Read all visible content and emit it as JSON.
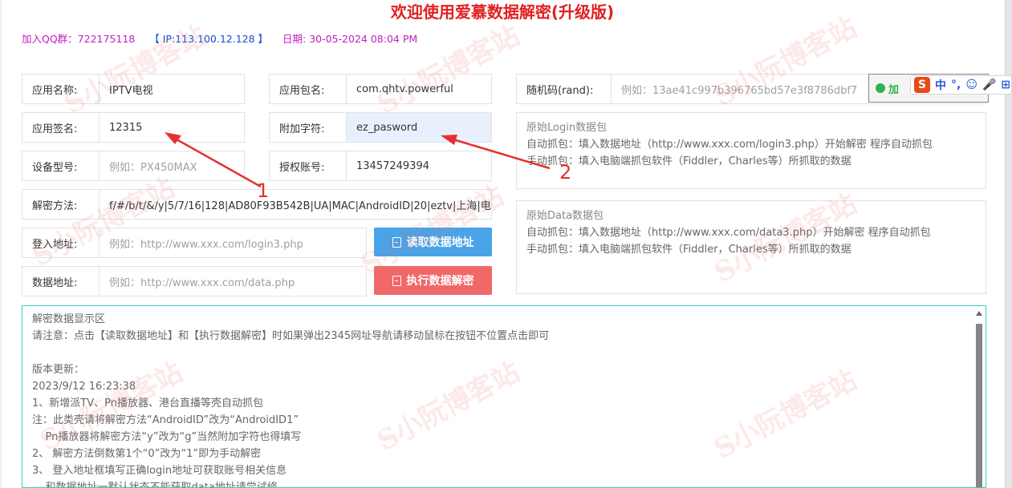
{
  "title": "欢迎使用爱慕数据解密(升级版)",
  "info": {
    "qq": "加入QQ群：722175118",
    "ip": "【 IP:113.100.12.128 】",
    "date": "日期: 30-05-2024 08:04 PM"
  },
  "fields": {
    "app_name": {
      "label": "应用名称:",
      "value": "IPTV电视"
    },
    "package_name": {
      "label": "应用包名:",
      "value": "com.qhtv.powerful"
    },
    "random_code": {
      "label": "随机码(rand):",
      "placeholder": "例如：13ae41c997b396765bd57e3f8786dbf7"
    },
    "app_signature": {
      "label": "应用签名:",
      "value": "12315"
    },
    "extra_chars": {
      "label": "附加字符:",
      "value": "ez_pasword"
    },
    "device_model": {
      "label": "设备型号:",
      "placeholder": "例如：PX450MAX"
    },
    "auth_account": {
      "label": "授权账号:",
      "value": "13457249394"
    },
    "decrypt_method": {
      "label": "解密方法:",
      "value": "f/#/b/t/&/y|5/7/16|128|AD80F93B542B|UA|MAC|AndroidID|20|eztv|上海|电信"
    },
    "login_url": {
      "label": "登入地址:",
      "placeholder": "例如：http://www.xxx.com/login3.php"
    },
    "data_url": {
      "label": "数据地址:",
      "placeholder": "例如：http://www.xxx.com/data.php"
    }
  },
  "buttons": {
    "read_address": "读取数据地址",
    "run_decrypt": "执行数据解密"
  },
  "login_pkt": {
    "head": "原始Login数据包",
    "line1": "自动抓包：填入数据地址（http://www.xxx.com/login3.php）开始解密 程序自动抓包",
    "line2": "手动抓包：填入电脑端抓包软件（Fiddler，Charles等）所抓取的数据"
  },
  "data_pkt": {
    "head": "原始Data数据包",
    "line1": "自动抓包：填入数据地址（http://www.xxx.com/data3.php）开始解密 程序自动抓包",
    "line2": "手动抓包：填入电脑端抓包软件（Fiddler，Charles等）所抓取的数据"
  },
  "ime": {
    "green_text": "加",
    "s_logo": "S",
    "items": [
      "中",
      "°,",
      "☺",
      "🎤",
      "⊞"
    ]
  },
  "output": {
    "lines": [
      "解密数据显示区",
      "请注意：点击【读取数据地址】和【执行数据解密】时如果弹出2345网址导航请移动鼠标在按钮不位置点击即可",
      "",
      "版本更新：",
      "2023/9/12 16:23:38",
      "1、新增派TV、Pn播放器、港台直播等壳自动抓包",
      "注：此类壳请将解密方法“AndroidID”改为“AndroidID1”",
      "    Pn播放器将解密方法“y”改为“g”当然附加字符也得填写",
      "2、 解密方法倒数第1个“0”改为“1”即为手动解密",
      "3、 登入地址框填写正确login地址可获取账号相关信息",
      "    和数据地址一默认状态不能获取data地址请尝试修"
    ]
  },
  "annotations": {
    "one": "1",
    "two": "2"
  },
  "watermark": "S小阮博客站"
}
